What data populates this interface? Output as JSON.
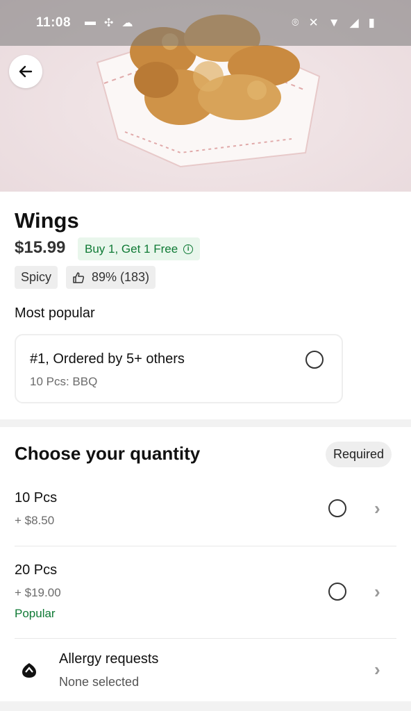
{
  "status_bar": {
    "time": "11:08"
  },
  "item": {
    "title": "Wings",
    "price": "$15.99",
    "promo": "Buy 1, Get 1 Free",
    "tags": {
      "spicy": "Spicy",
      "rating": "89% (183)"
    }
  },
  "most_popular": {
    "label": "Most popular",
    "card_title": "#1, Ordered by 5+ others",
    "card_sub": "10 Pcs: BBQ"
  },
  "quantity": {
    "title": "Choose your quantity",
    "required": "Required",
    "options": [
      {
        "name": "10 Pcs",
        "price": "+ $8.50",
        "badge": ""
      },
      {
        "name": "20 Pcs",
        "price": "+ $19.00",
        "badge": "Popular"
      }
    ]
  },
  "allergy": {
    "title": "Allergy requests",
    "sub": "None selected"
  },
  "colors": {
    "accent_green": "#0f7a35",
    "promo_bg": "#e9f6ec"
  },
  "icons": [
    "back-arrow-icon",
    "thumbs-up-icon",
    "info-icon",
    "radio-icon",
    "chevron-right-icon",
    "allergy-icon"
  ]
}
